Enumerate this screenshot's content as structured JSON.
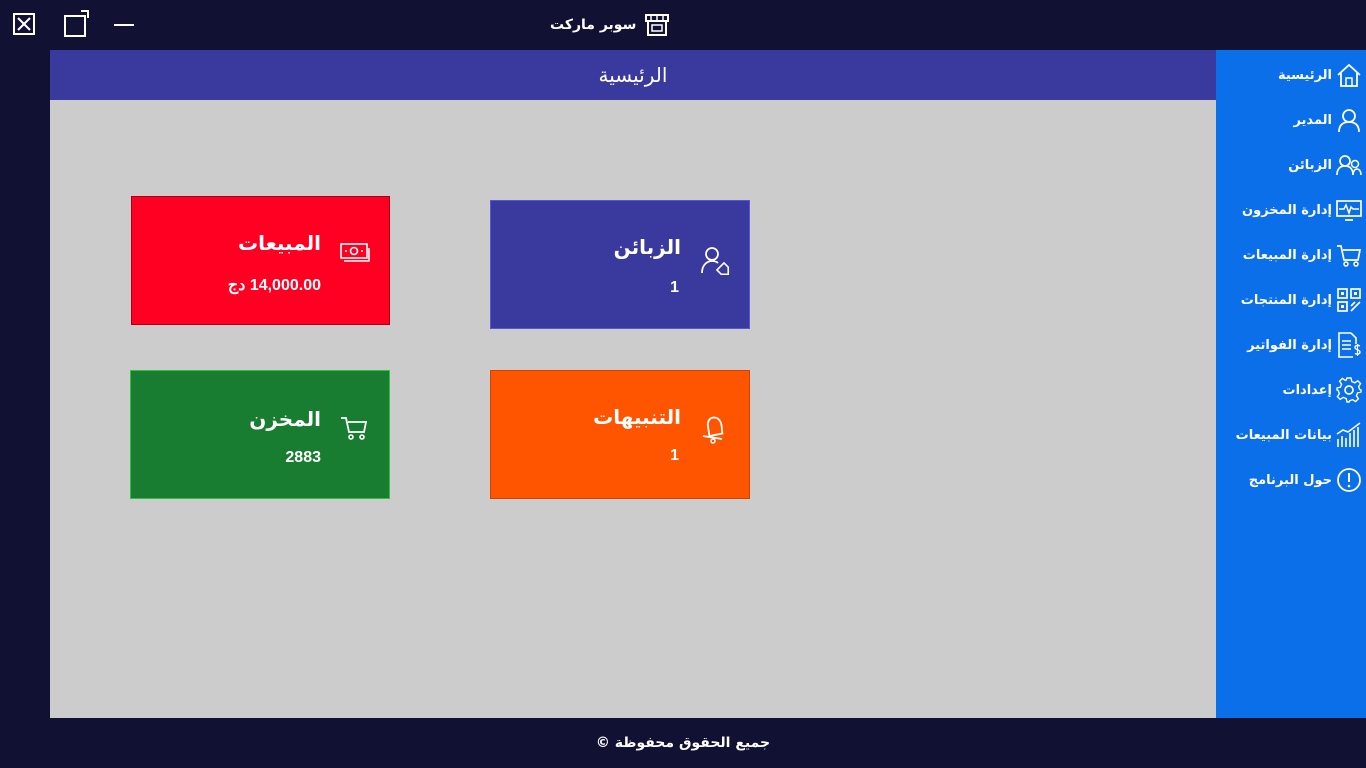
{
  "window": {
    "title": "سوبر ماركت",
    "title_icon": "store-icon",
    "controls": [
      "close-icon",
      "maximize-icon",
      "minimize-icon"
    ]
  },
  "main": {
    "header_title": "الرئيسية"
  },
  "cards": {
    "sales": {
      "title": "المبيعات",
      "value": "14,000.00 دج",
      "icon": "money-icon",
      "color": "#ff0022"
    },
    "customers": {
      "title": "الزبائن",
      "value": "1",
      "icon": "customer-tag-icon",
      "color": "#39399e"
    },
    "stock": {
      "title": "المخزن",
      "value": "2883",
      "icon": "cart-icon",
      "color": "#187d30"
    },
    "alerts": {
      "title": "التنبيهات",
      "value": "1",
      "icon": "bell-icon",
      "color": "#ff5500"
    }
  },
  "sidebar": {
    "items": [
      {
        "label": "الرئيسية",
        "icon": "home-icon"
      },
      {
        "label": "المدير",
        "icon": "user-icon"
      },
      {
        "label": "الزبائن",
        "icon": "users-icon"
      },
      {
        "label": "إدارة المخزون",
        "icon": "monitor-pulse-icon"
      },
      {
        "label": "إدارة المبيعات",
        "icon": "cart-icon"
      },
      {
        "label": "إدارة المنتجات",
        "icon": "qr-code-icon"
      },
      {
        "label": "إدارة الفواتير",
        "icon": "invoice-icon"
      },
      {
        "label": "إعدادات",
        "icon": "gear-icon"
      },
      {
        "label": "بيانات المبيعات",
        "icon": "bar-chart-icon"
      },
      {
        "label": "حول البرنامج",
        "icon": "info-icon"
      }
    ]
  },
  "footer": {
    "text": "جميع الحقوق محفوظة ©"
  },
  "colors": {
    "background": "#111133",
    "sidebar": "#0a6fe8",
    "header": "#39399e",
    "content": "#cccccc"
  }
}
